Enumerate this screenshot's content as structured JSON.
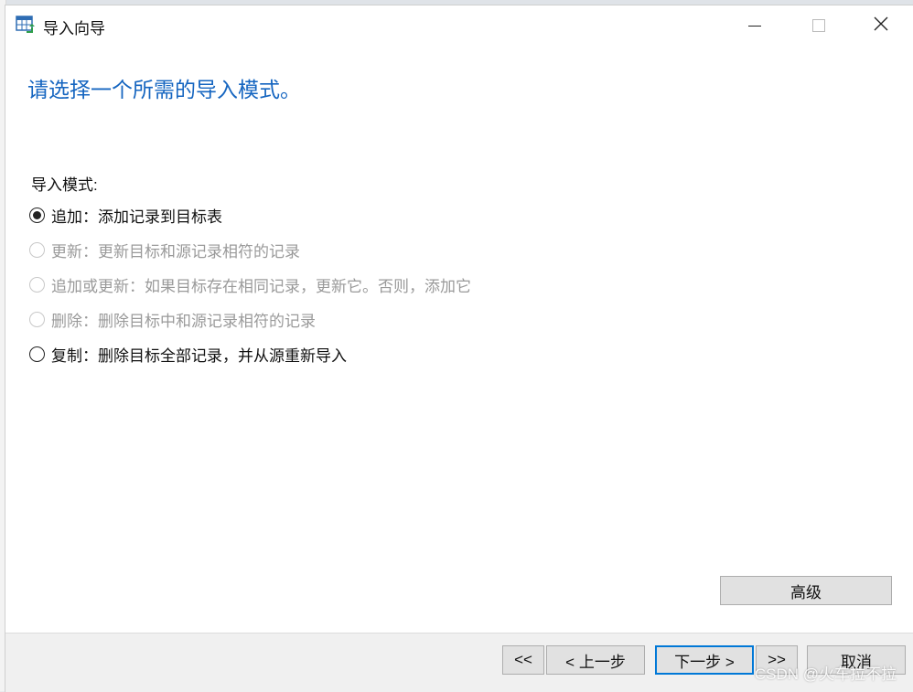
{
  "window": {
    "title": "导入向导",
    "minimize_icon": "minimize-icon",
    "maximize_icon": "maximize-icon",
    "close_icon": "close-icon"
  },
  "heading": "请选择一个所需的导入模式。",
  "modes": {
    "label": "导入模式:",
    "options": [
      {
        "text": "追加：添加记录到目标表",
        "selected": true,
        "enabled": true
      },
      {
        "text": "更新：更新目标和源记录相符的记录",
        "selected": false,
        "enabled": false
      },
      {
        "text": "追加或更新：如果目标存在相同记录，更新它。否则，添加它",
        "selected": false,
        "enabled": false
      },
      {
        "text": "删除：删除目标中和源记录相符的记录",
        "selected": false,
        "enabled": false
      },
      {
        "text": "复制：删除目标全部记录，并从源重新导入",
        "selected": false,
        "enabled": true
      }
    ]
  },
  "buttons": {
    "advanced": "高级",
    "first": "<<",
    "prev": "< 上一步",
    "next": "下一步 >",
    "last": ">>",
    "cancel": "取消"
  },
  "watermark": "CSDN @火车拉不拉",
  "colors": {
    "heading": "#1565c0",
    "primary_border": "#0078d7",
    "disabled_text": "#9a9a9a"
  }
}
